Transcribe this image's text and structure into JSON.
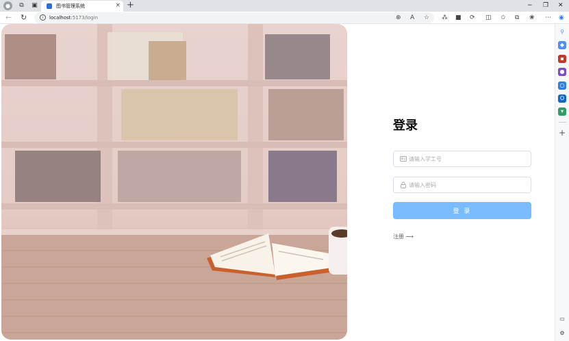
{
  "browser": {
    "tab_title": "图书管理系统",
    "tab_close": "×",
    "new_tab": "+",
    "url_host": "localhost",
    "url_path": ":5173/login",
    "window_controls": {
      "minimize": "−",
      "restore": "❐",
      "close": "✕"
    },
    "icons": [
      "back-icon",
      "refresh-icon",
      "info-icon",
      "zoom-icon",
      "read-aloud-icon",
      "favorite-icon",
      "extensions-icon",
      "split-screen-icon",
      "collections-icon",
      "more-icon"
    ]
  },
  "sidebar": {
    "colors": [
      "#4f8ef7",
      "#4f8ef7",
      "#c0392b",
      "#7d4bc6",
      "#2f7de1",
      "#0e6ac4",
      "#2f9e68"
    ],
    "add_label": "+"
  },
  "page": {
    "title": "登录",
    "username_placeholder": "请输入学工号",
    "password_placeholder": "请输入密码",
    "login_label": "登 录",
    "register_label": "注册 ⟶",
    "accent": "#79bbff"
  }
}
